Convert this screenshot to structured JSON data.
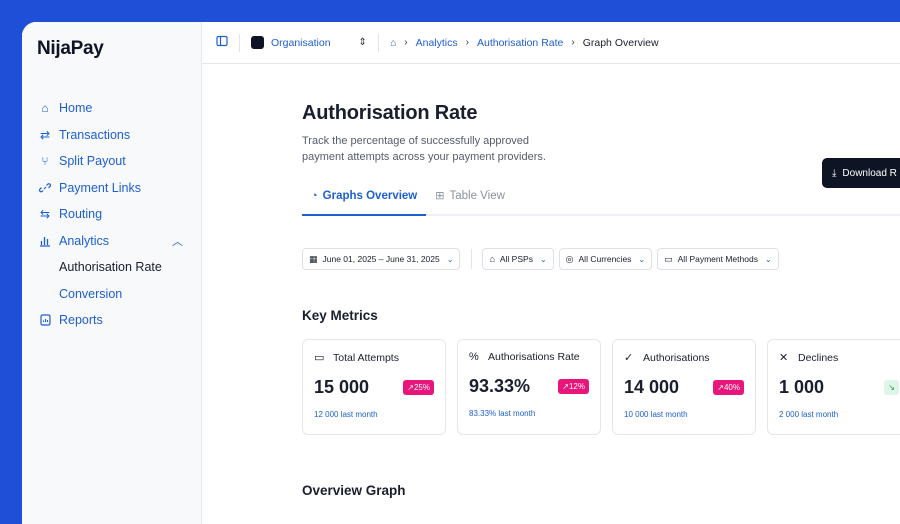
{
  "app": {
    "logo": "NijaPay"
  },
  "sidebar": {
    "items": [
      {
        "label": "Home",
        "icon": "⌂"
      },
      {
        "label": "Transactions",
        "icon": "⇄"
      },
      {
        "label": "Split Payout",
        "icon": "⑂"
      },
      {
        "label": "Payment Links",
        "icon": "🔗"
      },
      {
        "label": "Routing",
        "icon": "⇆"
      },
      {
        "label": "Analytics",
        "icon": "▥"
      },
      {
        "label": "Authorisation Rate"
      },
      {
        "label": "Conversion"
      },
      {
        "label": "Reports",
        "icon": "▤"
      }
    ]
  },
  "topbar": {
    "org": "Organisation",
    "breadcrumb": [
      "Analytics",
      "Authorisation Rate",
      "Graph Overview"
    ]
  },
  "page": {
    "title": "Authorisation Rate",
    "description": "Track the percentage of successfully approved payment attempts across your payment providers.",
    "download_label": "Download R"
  },
  "tabs": [
    {
      "label": "Graphs Overview"
    },
    {
      "label": "Table View"
    }
  ],
  "filters": {
    "date_range": "June 01, 2025 – June 31, 2025",
    "psps": "All PSPs",
    "currencies": "All Currencies",
    "methods": "All Payment Methods"
  },
  "key_metrics": {
    "heading": "Key Metrics",
    "cards": [
      {
        "label": "Total Attempts",
        "value": "15 000",
        "change": "↗25%",
        "sub": "12 000 last month"
      },
      {
        "label": "Authorisations Rate",
        "value": "93.33%",
        "change": "↗12%",
        "sub": "83.33% last month"
      },
      {
        "label": "Authorisations",
        "value": "14 000",
        "change": "↗40%",
        "sub": "10 000 last month"
      },
      {
        "label": "Declines",
        "value": "1 000",
        "change": "↘",
        "sub": "2 000 last month"
      }
    ]
  },
  "overview_graph": {
    "heading": "Overview Graph"
  },
  "colors": {
    "brand_blue": "#1d5fd1",
    "background": "#1f4fd6",
    "badge_pink": "#e8157a",
    "dark": "#0f1424"
  }
}
